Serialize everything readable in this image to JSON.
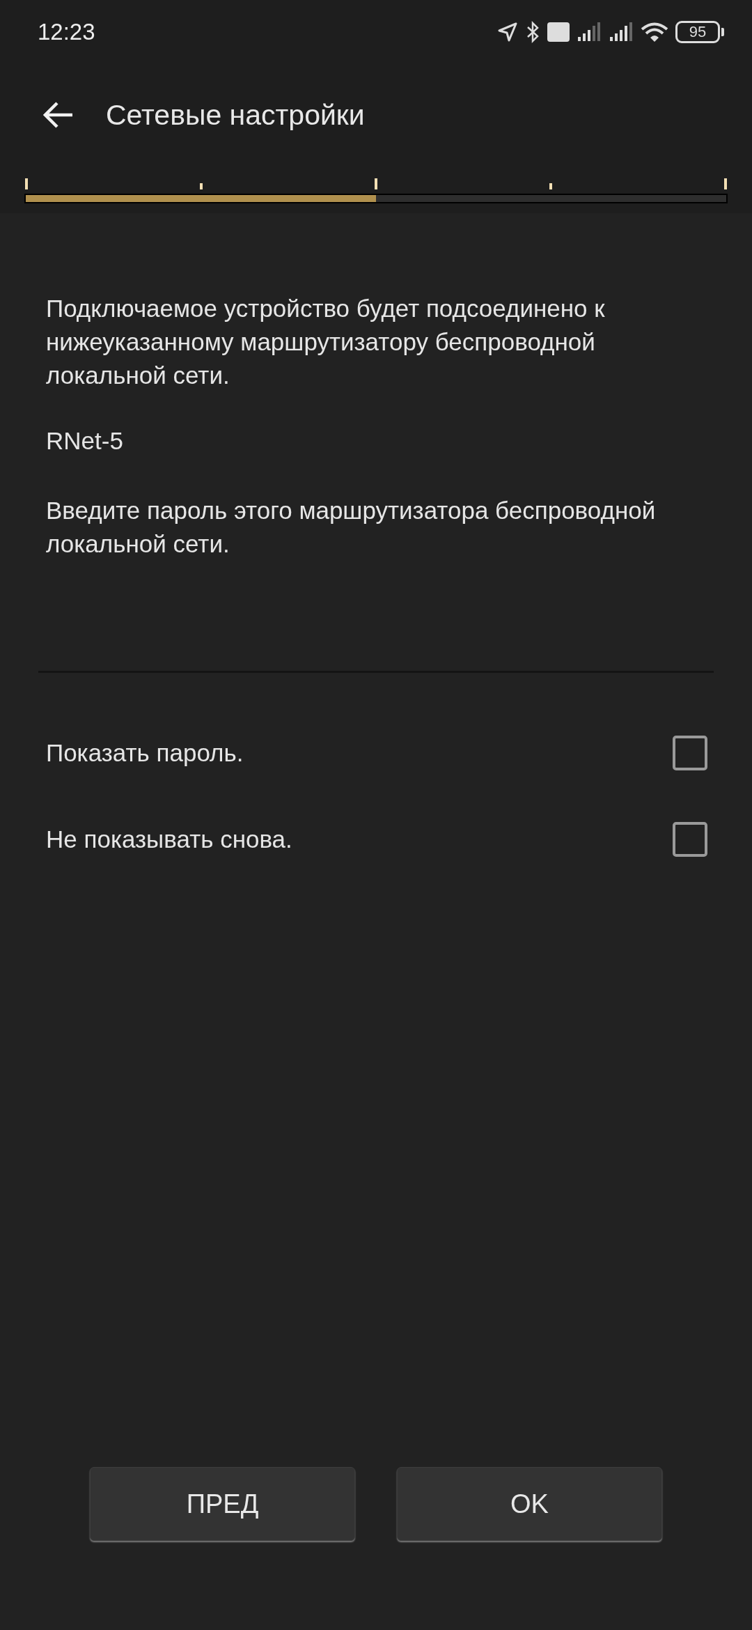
{
  "status_bar": {
    "time": "12:23",
    "battery": "95"
  },
  "app_bar": {
    "title": "Сетевые настройки"
  },
  "progress": {
    "level": 0.5
  },
  "intro": "Подключаемое устройство будет подсоединено к нижеуказанному маршрутизатору беспроводной локальной сети.",
  "network_name": "RNet-5",
  "password_prompt": "Введите пароль этого маршрутизатора беспроводной локальной сети.",
  "options": [
    {
      "label": "Показать пароль.",
      "checked": false
    },
    {
      "label": "Не показывать снова.",
      "checked": false
    }
  ],
  "buttons": [
    "ПРЕД",
    "OK"
  ]
}
